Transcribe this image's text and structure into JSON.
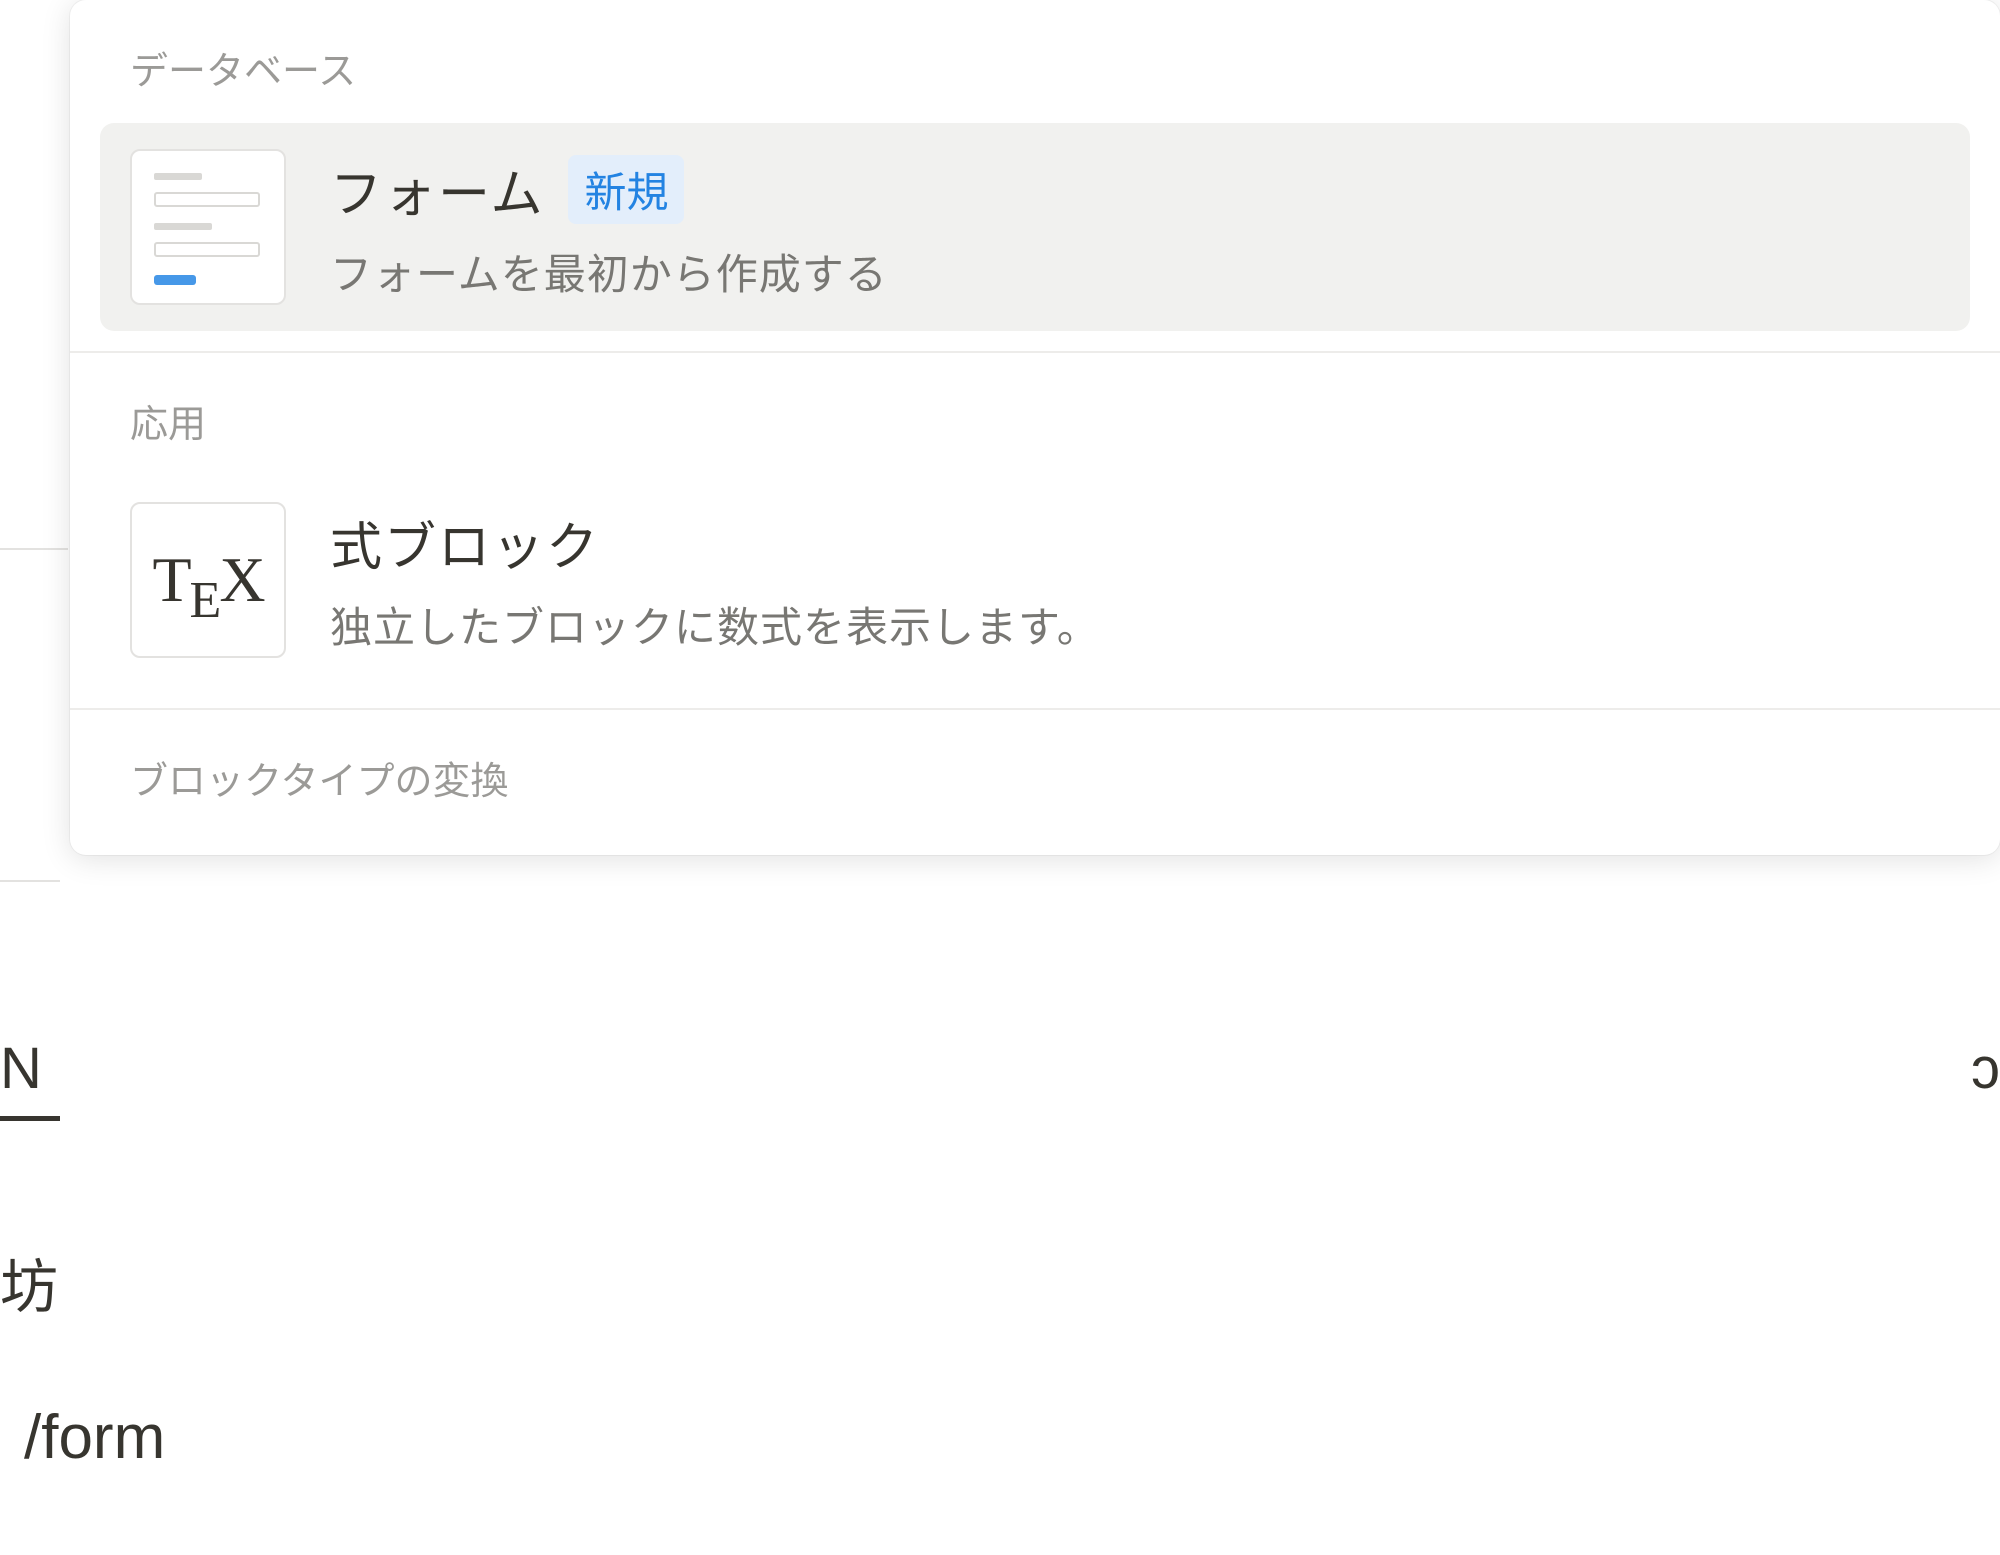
{
  "sections": {
    "database": {
      "label": "データベース",
      "items": [
        {
          "title": "フォーム",
          "badge": "新規",
          "description": "フォームを最初から作成する",
          "icon": "form-icon"
        }
      ]
    },
    "advanced": {
      "label": "応用",
      "items": [
        {
          "title": "式ブロック",
          "description": "独立したブロックに数式を表示します。",
          "icon": "tex-icon"
        }
      ]
    },
    "transform": {
      "label": "ブロックタイプの変換"
    }
  },
  "input": {
    "text": "/form"
  },
  "colors": {
    "accent": "#2383e2",
    "badge_bg": "#e3eefb"
  }
}
